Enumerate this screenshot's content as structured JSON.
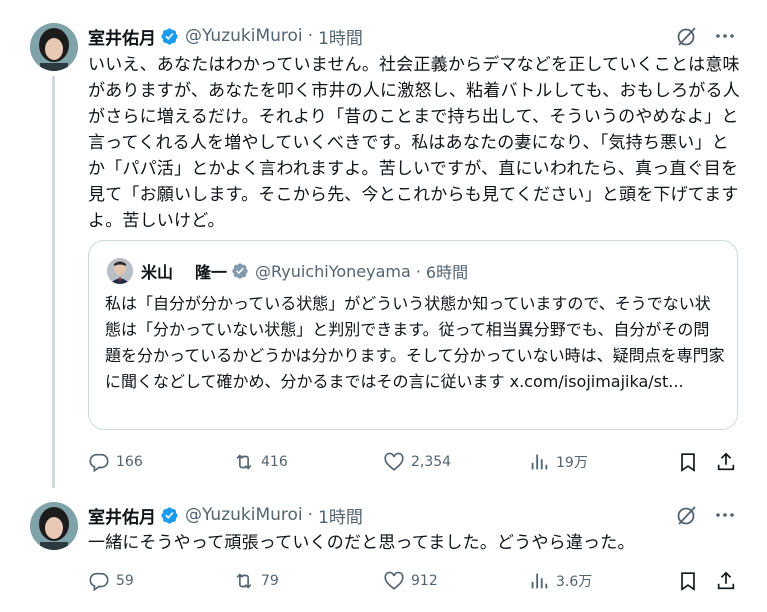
{
  "tweets": [
    {
      "author": {
        "name": "室井佑月",
        "handle": "@YuzukiMuroi",
        "verified": true
      },
      "time": "1時間",
      "text": "いいえ、あなたはわかっていません。社会正義からデマなどを正していくことは意味がありますが、あなたを叩く市井の人に激怒し、粘着バトルしても、おもしろがる人がさらに増えるだけ。それより「昔のことまで持ち出して、そういうのやめなよ」と言ってくれる人を増やしていくべきです。私はあなたの妻になり、「気持ち悪い」とか「パパ活」とかよく言われますよ。苦しいですが、直にいわれたら、真っ直ぐ目を見て「お願いします。そこから先、今とこれからも見てください」と頭を下げてますよ。苦しいけど。",
      "quote": {
        "author": {
          "name_family": "米山",
          "name_given": "隆一",
          "handle": "@RyuichiYoneyama",
          "verified": true
        },
        "time": "6時間",
        "text": "私は「自分が分かっている状態」がどういう状態か知っていますので、そうでない状態は「分かっていない状態」と判別できます。従って相当異分野でも、自分がその問題を分かっているかどうかは分かります。そして分かっていない時は、疑問点を専門家に聞くなどして確かめ、分かるまではその言に従います",
        "link": "x.com/isojimajika/st..."
      },
      "stats": {
        "replies": "166",
        "retweets": "416",
        "likes": "2,354",
        "views": "19万"
      }
    },
    {
      "author": {
        "name": "室井佑月",
        "handle": "@YuzukiMuroi",
        "verified": true
      },
      "time": "1時間",
      "text": "一緒にそうやって頑張っていくのだと思ってました。どうやら違った。",
      "stats": {
        "replies": "59",
        "retweets": "79",
        "likes": "912",
        "views": "3.6万"
      }
    }
  ],
  "icons": {
    "reply": "reply-icon",
    "retweet": "retweet-icon",
    "like": "heart-icon",
    "views": "views-chart-icon",
    "bookmark": "bookmark-icon",
    "share": "share-icon",
    "grok": "grok-icon",
    "more": "more-icon",
    "verified": "verified-badge-icon"
  },
  "colors": {
    "verified_blue": "#1d9bf0",
    "text": "#0f1419",
    "secondary": "#536471",
    "border": "#cfd9de"
  }
}
